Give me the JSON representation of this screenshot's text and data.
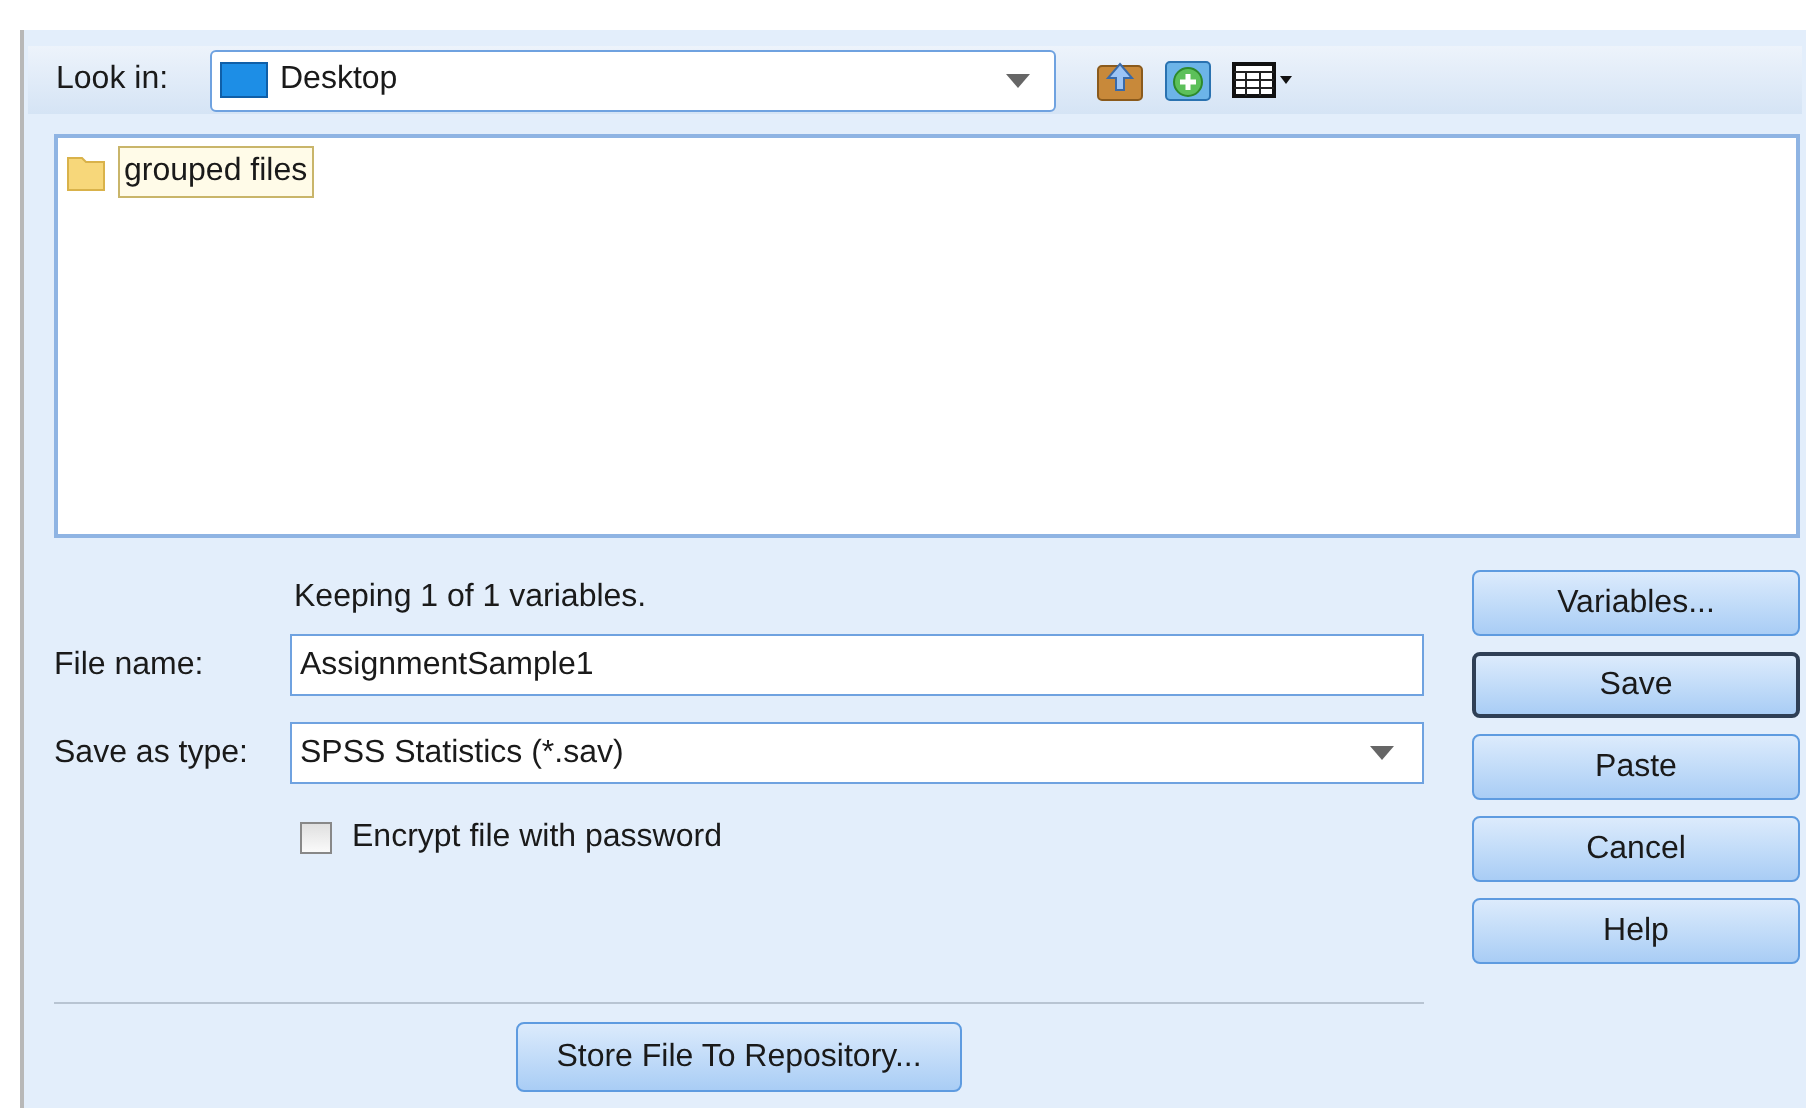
{
  "look_in": {
    "label": "Look in:",
    "value": "Desktop"
  },
  "files": [
    {
      "name": "grouped files",
      "selected": true
    }
  ],
  "status": "Keeping 1 of 1 variables.",
  "file_name": {
    "label": "File name:",
    "value": "AssignmentSample1"
  },
  "save_as_type": {
    "label": "Save as type:",
    "value": "SPSS Statistics (*.sav)"
  },
  "encrypt": {
    "label": "Encrypt file with password",
    "checked": false
  },
  "buttons": [
    {
      "label": "Variables...",
      "default": false
    },
    {
      "label": "Save",
      "default": true
    },
    {
      "label": "Paste",
      "default": false
    },
    {
      "label": "Cancel",
      "default": false
    },
    {
      "label": "Help",
      "default": false
    }
  ],
  "repository_button": "Store File To Repository..."
}
